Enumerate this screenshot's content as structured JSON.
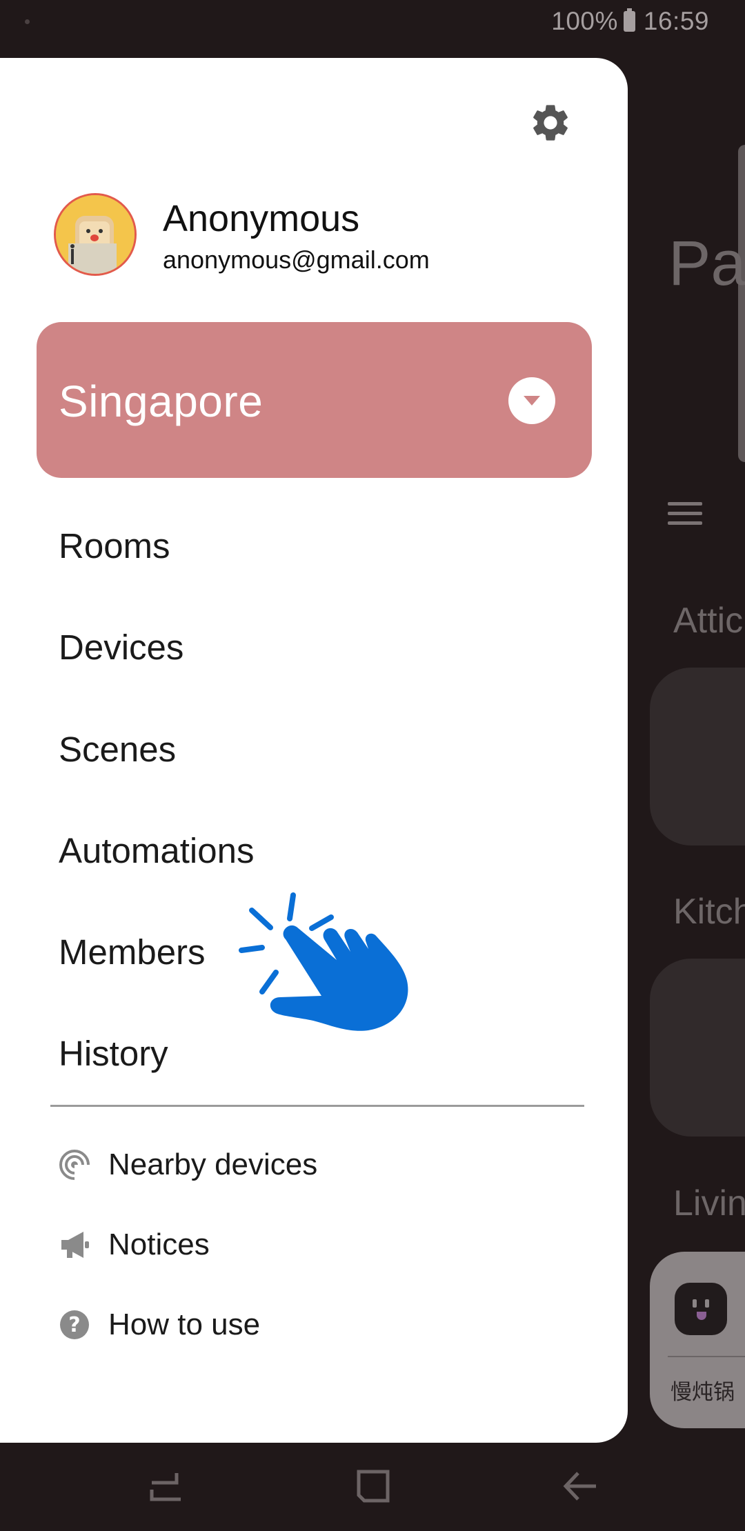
{
  "status_bar": {
    "battery": "100%",
    "time": "16:59"
  },
  "background_app": {
    "title_partial": "Pa",
    "sections": [
      "Attic",
      "Kitch",
      "Livin"
    ],
    "device_label": "慢炖锅"
  },
  "drawer": {
    "user": {
      "name": "Anonymous",
      "email": "anonymous@gmail.com"
    },
    "location": {
      "label": "Singapore"
    },
    "menu": [
      {
        "label": "Rooms"
      },
      {
        "label": "Devices"
      },
      {
        "label": "Scenes"
      },
      {
        "label": "Automations"
      },
      {
        "label": "Members"
      },
      {
        "label": "History"
      }
    ],
    "sub_menu": [
      {
        "label": "Nearby devices",
        "icon": "nearby-icon"
      },
      {
        "label": "Notices",
        "icon": "megaphone-icon"
      },
      {
        "label": "How to use",
        "icon": "help-icon"
      }
    ]
  },
  "colors": {
    "location_accent": "#cf8586",
    "tap_hand": "#0a6fd6",
    "background": "#201819"
  }
}
